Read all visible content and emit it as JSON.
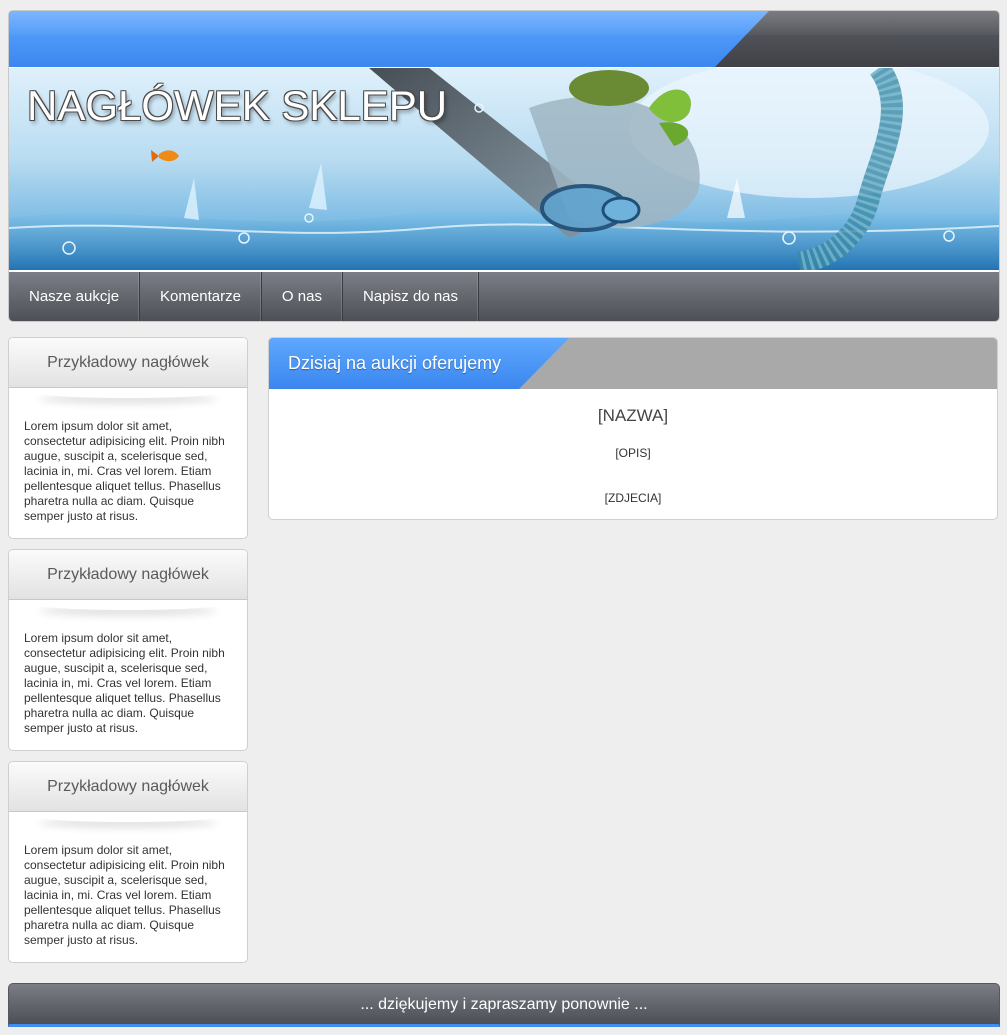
{
  "header": {
    "shop_title": "NAGŁÓWEK SKLEPU"
  },
  "nav": {
    "items": [
      "Nasze aukcje",
      "Komentarze",
      "O nas",
      "Napisz do nas"
    ]
  },
  "sidebar": {
    "boxes": [
      {
        "title": "Przykładowy nagłówek",
        "text": "Lorem ipsum dolor sit amet, consectetur adipisicing elit. Proin nibh augue, suscipit a, scelerisque sed, lacinia in, mi. Cras vel lorem. Etiam pellentesque aliquet tellus. Phasellus pharetra nulla ac diam. Quisque semper justo at risus."
      },
      {
        "title": "Przykładowy nagłówek",
        "text": "Lorem ipsum dolor sit amet, consectetur adipisicing elit. Proin nibh augue, suscipit a, scelerisque sed, lacinia in, mi. Cras vel lorem. Etiam pellentesque aliquet tellus. Phasellus pharetra nulla ac diam. Quisque semper justo at risus."
      },
      {
        "title": "Przykładowy nagłówek",
        "text": "Lorem ipsum dolor sit amet, consectetur adipisicing elit. Proin nibh augue, suscipit a, scelerisque sed, lacinia in, mi. Cras vel lorem. Etiam pellentesque aliquet tellus. Phasellus pharetra nulla ac diam. Quisque semper justo at risus."
      }
    ]
  },
  "main": {
    "title": "Dzisiaj na aukcji oferujemy",
    "name": "[NAZWA]",
    "description": "[OPIS]",
    "photos": "[ZDJECIA]"
  },
  "footer": {
    "text": "... dziękujemy i zapraszamy ponownie ..."
  },
  "colors": {
    "accent_blue": "#3a87ef",
    "dark_bar": "#4e5057",
    "background": "#eeeeee"
  }
}
